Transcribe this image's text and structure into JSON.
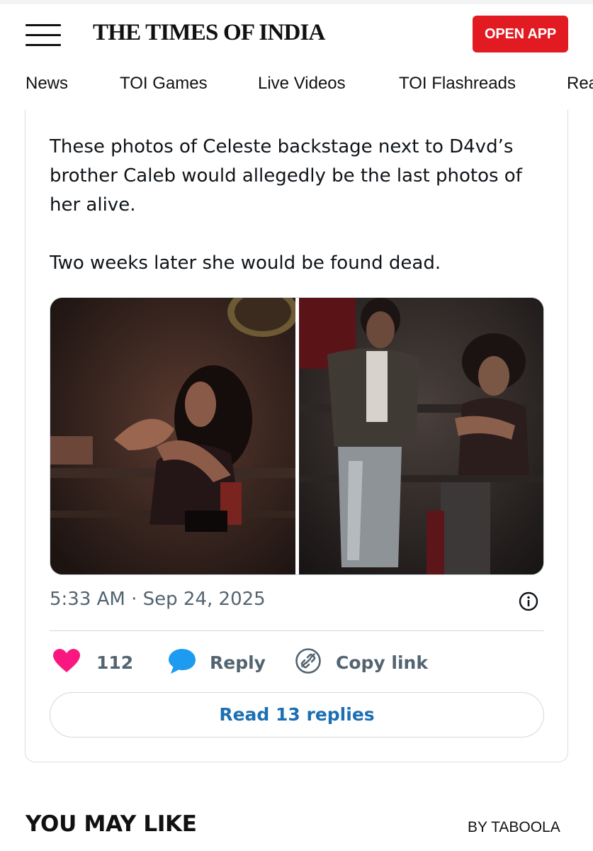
{
  "header": {
    "logo_text": "THE TIMES OF INDIA",
    "open_app_label": "OPEN APP",
    "brand_color": "#e21b22"
  },
  "nav": {
    "items": [
      "News",
      "TOI Games",
      "Live Videos",
      "TOI Flashreads",
      "Rea"
    ]
  },
  "tweet": {
    "paragraphs": [
      "These photos of Celeste backstage next to D4vd’s brother Caleb would allegedly be the last photos of her alive.",
      "Two weeks later she would be found dead."
    ],
    "media": {
      "photo_count": 2,
      "icons": [
        "photo-left",
        "photo-right"
      ]
    },
    "timestamp": "5:33 AM · Sep 24, 2025",
    "info_icon": "info-icon",
    "actions": {
      "like_count": "112",
      "like_color": "#f91880",
      "reply_label": "Reply",
      "reply_color": "#1d9bf0",
      "copy_label": "Copy link"
    },
    "read_replies_label": "Read 13 replies",
    "link_color": "#1d6fb3"
  },
  "footer": {
    "section_title": "YOU MAY LIKE",
    "taboola_label": "BY TABOOLA"
  }
}
